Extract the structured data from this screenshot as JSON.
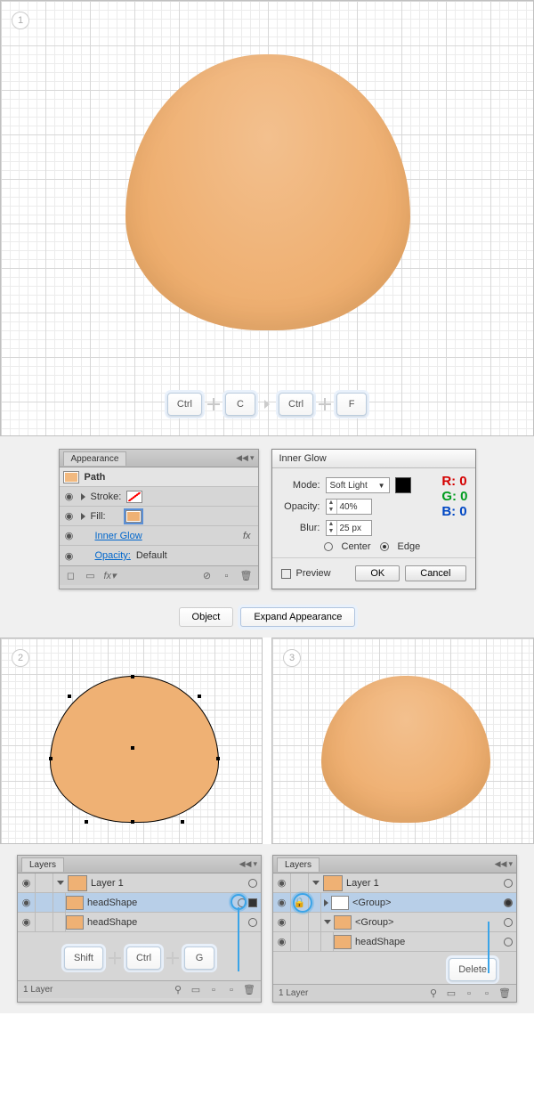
{
  "steps": {
    "s1": "1",
    "s2": "2",
    "s3": "3"
  },
  "shortcut1": {
    "k1": "Ctrl",
    "k2": "C",
    "k3": "Ctrl",
    "k4": "F"
  },
  "appearance": {
    "title": "Appearance",
    "path": "Path",
    "stroke": "Stroke:",
    "fill": "Fill:",
    "innerGlow": "Inner Glow",
    "opacity": "Opacity:",
    "opacityDefault": "Default",
    "fxLabel": "fx"
  },
  "innerGlow": {
    "title": "Inner Glow",
    "modeLabel": "Mode:",
    "modeValue": "Soft Light",
    "opacityLabel": "Opacity:",
    "opacityValue": "40%",
    "blurLabel": "Blur:",
    "blurValue": "25 px",
    "center": "Center",
    "edge": "Edge",
    "preview": "Preview",
    "ok": "OK",
    "cancel": "Cancel",
    "rgb": {
      "r": "R: 0",
      "g": "G: 0",
      "b": "B: 0"
    }
  },
  "menubar": {
    "object": "Object",
    "expand": "Expand Appearance"
  },
  "layersA": {
    "title": "Layers",
    "layer1": "Layer 1",
    "head1": "headShape",
    "head2": "headShape",
    "status": "1 Layer",
    "shortcut": {
      "shift": "Shift",
      "ctrl": "Ctrl",
      "g": "G"
    }
  },
  "layersB": {
    "title": "Layers",
    "layer1": "Layer 1",
    "group1": "<Group>",
    "group2": "<Group>",
    "head": "headShape",
    "status": "1 Layer",
    "shortcut": "Delete"
  }
}
